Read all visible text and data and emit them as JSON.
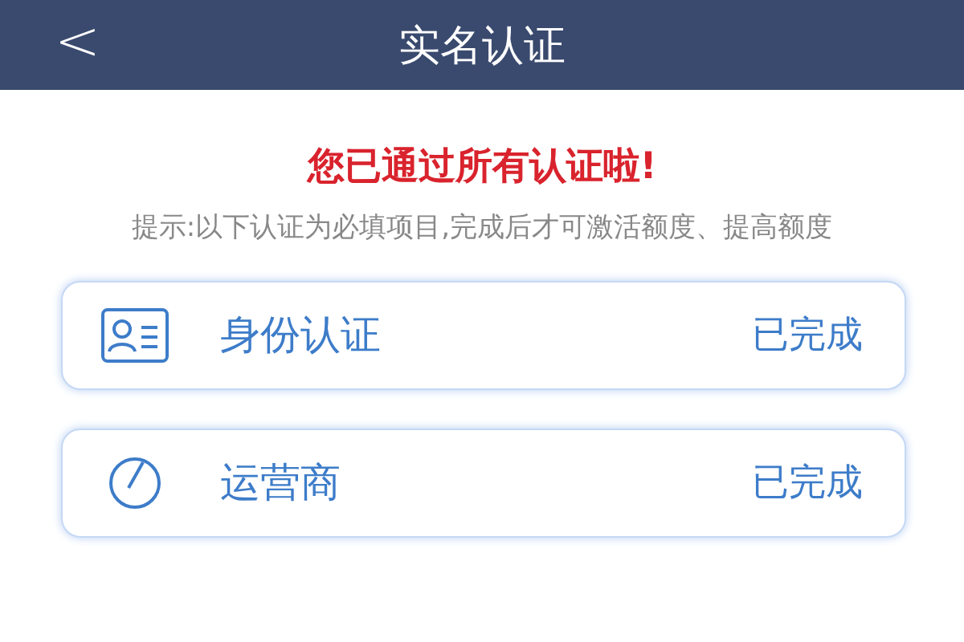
{
  "header": {
    "back": "<",
    "title": "实名认证"
  },
  "notice": "您已通过所有认证啦!",
  "hint": "提示:以下认证为必填项目,完成后才可激活额度、提高额度",
  "items": [
    {
      "kind": "card",
      "label": "身份认证",
      "status": "已完成"
    },
    {
      "kind": "circle",
      "label": "运营商",
      "status": "已完成"
    }
  ]
}
